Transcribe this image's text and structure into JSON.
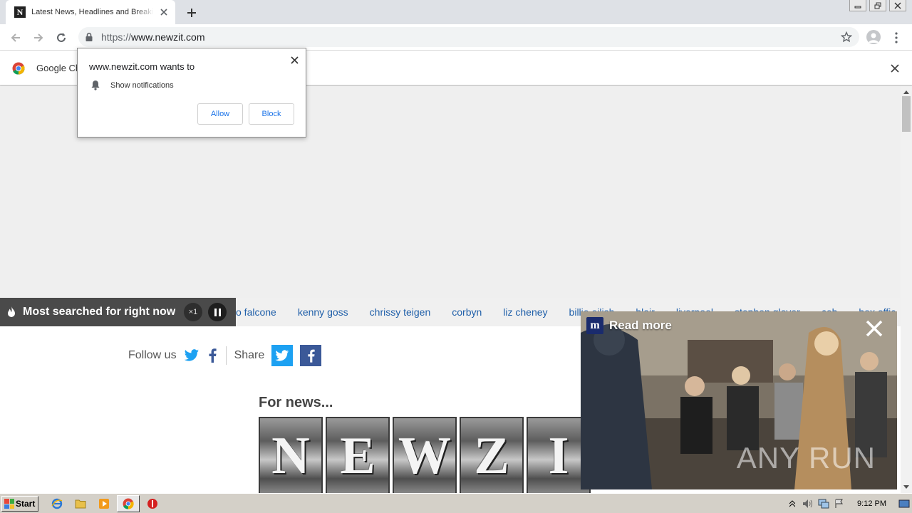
{
  "browser": {
    "tab_title": "Latest News, Headlines and Breaking News",
    "tab_favicon_letter": "N",
    "url_scheme": "https://",
    "url_host": "www.newzit.com"
  },
  "infobar": {
    "text": "Google Ch"
  },
  "permission_prompt": {
    "title": "www.newzit.com wants to",
    "item": "Show notifications",
    "allow_label": "Allow",
    "block_label": "Block"
  },
  "trending": {
    "title": "Most searched for right now",
    "speed": "×1",
    "items": [
      "o falcone",
      "kenny goss",
      "chrissy teigen",
      "corbyn",
      "liz cheney",
      "billie eilish",
      "blair",
      "liverpool",
      "stephen glover",
      "ceb",
      "box offic"
    ]
  },
  "social": {
    "follow_label": "Follow us",
    "share_label": "Share"
  },
  "content": {
    "for_news": "For news...",
    "logo_letters": [
      "N",
      "E",
      "W",
      "Z",
      "I"
    ]
  },
  "video_ad": {
    "badge": "m",
    "read_more": "Read more",
    "watermark": "ANY RUN"
  },
  "taskbar": {
    "start_label": "Start",
    "clock": "9:12 PM"
  },
  "colors": {
    "link": "#1f5fa9",
    "twitter": "#1da1f2",
    "facebook": "#3b5998",
    "trend_label_bg": "#4a4a4a"
  }
}
